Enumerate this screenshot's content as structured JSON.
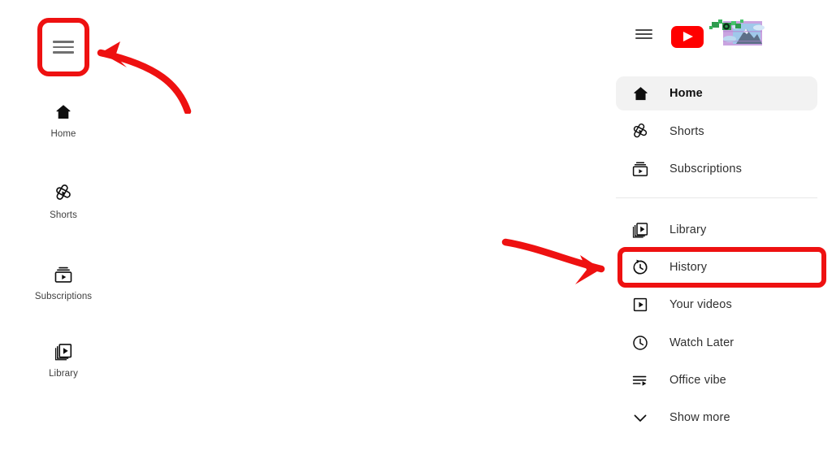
{
  "app": {
    "name": "YouTube",
    "brand_color": "#ff0000",
    "annotation_color": "#ee1111",
    "background": "#ffffff"
  },
  "mini_sidebar": {
    "hamburger": {
      "icon": "hamburger-menu-icon",
      "label": ""
    },
    "items": [
      {
        "label": "Home",
        "icon": "home-icon"
      },
      {
        "label": "Shorts",
        "icon": "shorts-icon"
      },
      {
        "label": "Subscriptions",
        "icon": "subscriptions-icon"
      },
      {
        "label": "Library",
        "icon": "library-icon"
      }
    ]
  },
  "panel": {
    "header": {
      "hamburger": {
        "icon": "hamburger-menu-icon"
      },
      "logo": {
        "icon": "youtube-play-badge-icon",
        "color": "#ff0000"
      },
      "wordmark": {
        "icon": "broken-image-placeholder-icon",
        "alt": "YouTube",
        "state": "corrupted",
        "colors": [
          "#c9a3e0",
          "#8fc4e8",
          "#2e9b4e",
          "#6f7f95"
        ]
      }
    },
    "primary_items": [
      {
        "label": "Home",
        "icon": "home-icon",
        "active": true
      },
      {
        "label": "Shorts",
        "icon": "shorts-icon",
        "active": false
      },
      {
        "label": "Subscriptions",
        "icon": "subscriptions-icon",
        "active": false
      }
    ],
    "secondary_items": [
      {
        "label": "Library",
        "icon": "library-icon",
        "active": false
      },
      {
        "label": "History",
        "icon": "history-clock-icon",
        "active": false
      },
      {
        "label": "Your videos",
        "icon": "your-videos-icon",
        "active": false
      },
      {
        "label": "Watch Later",
        "icon": "clock-icon",
        "active": false
      },
      {
        "label": "Office vibe",
        "icon": "playlist-icon",
        "active": false
      },
      {
        "label": "Show more",
        "icon": "chevron-down-icon",
        "active": false
      }
    ]
  },
  "annotations": [
    {
      "id": "hamburger-highlight",
      "type": "rounded-rectangle-outline",
      "target": "mini-sidebar-hamburger-button",
      "color": "#ee1111"
    },
    {
      "id": "hamburger-arrow",
      "type": "curved-arrow",
      "direction": "points-up-left",
      "color": "#ee1111"
    },
    {
      "id": "history-highlight",
      "type": "rounded-rectangle-outline",
      "target": "panel-nav-item-history",
      "color": "#ee1111"
    },
    {
      "id": "history-arrow",
      "type": "curved-arrow",
      "direction": "points-right",
      "color": "#ee1111"
    }
  ]
}
